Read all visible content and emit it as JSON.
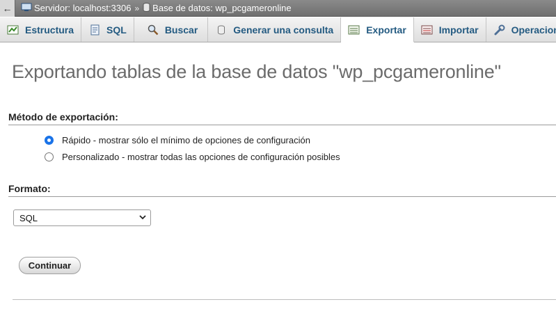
{
  "breadcrumb": {
    "back": "←",
    "server": "Servidor: localhost:3306",
    "separator": "»",
    "database": "Base de datos: wp_pcgameronline"
  },
  "tabs": [
    {
      "label": "Estructura",
      "icon": "structure-icon",
      "active": false
    },
    {
      "label": "SQL",
      "icon": "sql-icon",
      "active": false
    },
    {
      "label": "Buscar",
      "icon": "search-icon",
      "active": false
    },
    {
      "label": "Generar una consulta",
      "icon": "query-icon",
      "active": false
    },
    {
      "label": "Exportar",
      "icon": "export-icon",
      "active": true
    },
    {
      "label": "Importar",
      "icon": "import-icon",
      "active": false
    },
    {
      "label": "Operaciones",
      "icon": "wrench-icon",
      "active": false
    }
  ],
  "page": {
    "title": "Exportando tablas de la base de datos \"wp_pcgameronline\""
  },
  "export_method": {
    "heading": "Método de exportación:",
    "options": [
      {
        "label": "Rápido - mostrar sólo el mínimo de opciones de configuración",
        "checked": true
      },
      {
        "label": "Personalizado - mostrar todas las opciones de configuración posibles",
        "checked": false
      }
    ]
  },
  "format": {
    "heading": "Formato:",
    "selected": "SQL"
  },
  "actions": {
    "continue_label": "Continuar"
  },
  "colors": {
    "tab_text": "#235a81",
    "radio_accent": "#1a73e8",
    "breadcrumb_bg": "#7a7a7a"
  }
}
